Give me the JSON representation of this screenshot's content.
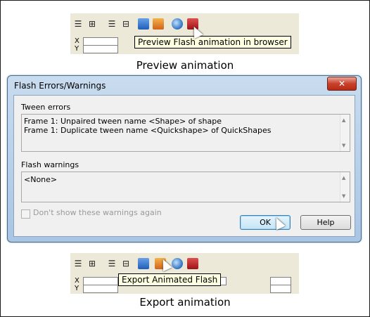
{
  "top_toolbar": {
    "tooltip": "Preview Flash animation in browser",
    "x_label": "X",
    "y_label": "Y",
    "caption": "Preview animation"
  },
  "dialog": {
    "title": "Flash Errors/Warnings",
    "close_label": "✕",
    "tween_errors_label": "Tween errors",
    "tween_errors": [
      "Frame 1: Unpaired tween name <Shape> of shape",
      "Frame 1: Duplicate tween name <Quickshape> of QuickShapes"
    ],
    "flash_warnings_label": "Flash warnings",
    "flash_warnings": [
      "<None>"
    ],
    "dont_show_label": "Don't show these warnings again",
    "ok_label": "OK",
    "help_label": "Help"
  },
  "bottom_toolbar": {
    "tooltip": "Export Animated Flash",
    "x_label": "X",
    "y_label": "Y",
    "caption": "Export animation"
  }
}
